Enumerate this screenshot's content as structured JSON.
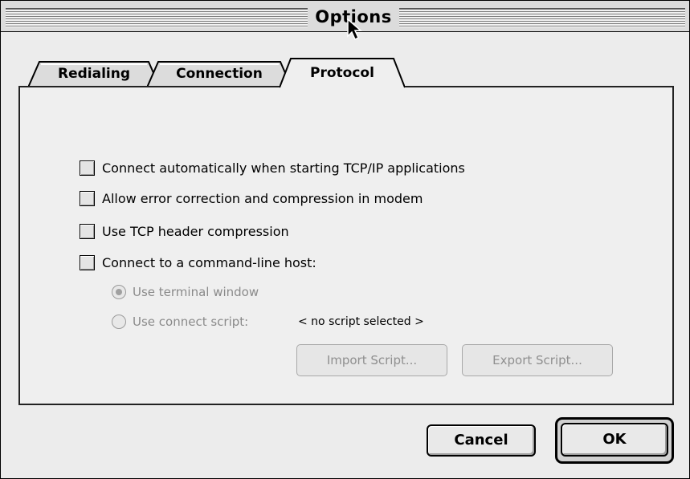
{
  "window": {
    "title": "Options"
  },
  "tabs": [
    {
      "label": "Redialing",
      "active": false
    },
    {
      "label": "Connection",
      "active": false
    },
    {
      "label": "Protocol",
      "active": true
    }
  ],
  "protocol": {
    "options": [
      {
        "label": "Connect automatically when starting TCP/IP applications",
        "checked": false
      },
      {
        "label": "Allow error correction and compression in modem",
        "checked": false
      },
      {
        "label": "Use TCP header compression",
        "checked": false
      },
      {
        "label": "Connect to a command-line host:",
        "checked": false
      }
    ],
    "radio_terminal": {
      "label": "Use terminal window",
      "selected": true,
      "enabled": false
    },
    "radio_script": {
      "label": "Use connect script:",
      "selected": false,
      "enabled": false
    },
    "script_value": "< no script selected >",
    "import_button": "Import Script...",
    "export_button": "Export Script..."
  },
  "buttons": {
    "cancel": "Cancel",
    "ok": "OK"
  },
  "colors": {
    "window_bg": "#ececec",
    "disabled_text": "#8a8a8a"
  }
}
